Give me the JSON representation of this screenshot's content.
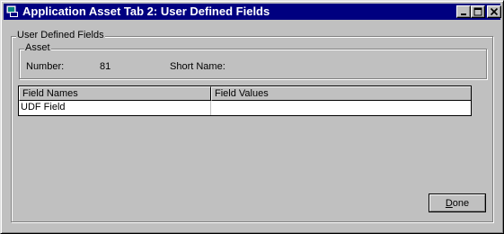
{
  "window": {
    "title": "Application Asset Tab 2: User Defined Fields"
  },
  "titlebar_buttons": {
    "minimize_icon": "minimize-icon",
    "maximize_icon": "maximize-icon",
    "close_icon": "close-icon"
  },
  "user_defined_fields_group": {
    "label": "User Defined Fields"
  },
  "asset_group": {
    "label": "Asset",
    "number_label": "Number:",
    "number_value": "81",
    "short_name_label": "Short Name:",
    "short_name_value": ""
  },
  "grid": {
    "columns": [
      "Field Names",
      "Field Values"
    ],
    "rows": [
      {
        "name": "UDF Field",
        "value": ""
      }
    ]
  },
  "done_button": {
    "label": "Done"
  }
}
